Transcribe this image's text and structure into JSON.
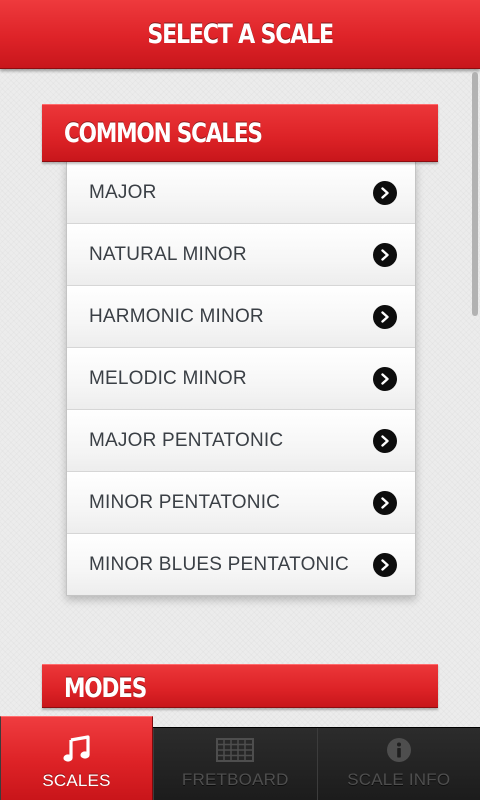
{
  "header": {
    "title": "SELECT A SCALE"
  },
  "sections": {
    "common": {
      "title": "COMMON SCALES",
      "items": [
        {
          "label": "MAJOR"
        },
        {
          "label": "NATURAL MINOR"
        },
        {
          "label": "HARMONIC MINOR"
        },
        {
          "label": "MELODIC MINOR"
        },
        {
          "label": "MAJOR PENTATONIC"
        },
        {
          "label": "MINOR PENTATONIC"
        },
        {
          "label": "MINOR BLUES PENTATONIC"
        }
      ]
    },
    "modes": {
      "title": "MODES"
    }
  },
  "tabs": [
    {
      "label": "SCALES",
      "icon": "music-note-icon",
      "active": true
    },
    {
      "label": "FRETBOARD",
      "icon": "fretboard-grid-icon",
      "active": false
    },
    {
      "label": "SCALE INFO",
      "icon": "info-icon",
      "active": false
    }
  ],
  "colors": {
    "accent": "#dd2226",
    "tab_bar": "#222222",
    "item_text": "#3a3f45"
  }
}
